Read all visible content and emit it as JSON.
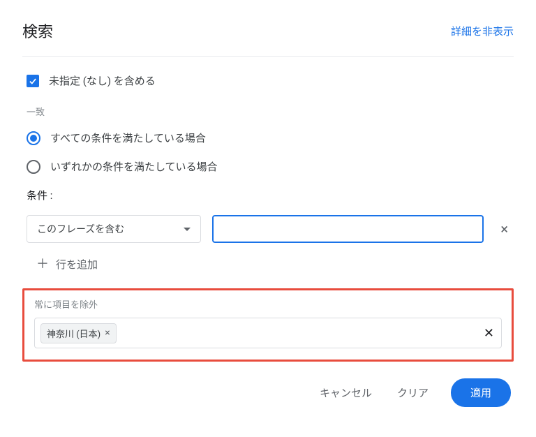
{
  "header": {
    "title": "検索",
    "hide_details": "詳細を非表示"
  },
  "include_unspecified": {
    "label": "未指定 (なし) を含める",
    "checked": true
  },
  "match": {
    "section_label": "一致",
    "options": [
      {
        "label": "すべての条件を満たしている場合",
        "selected": true
      },
      {
        "label": "いずれかの条件を満たしている場合",
        "selected": false
      }
    ]
  },
  "conditions": {
    "label": "条件 :",
    "rows": [
      {
        "dropdown": "このフレーズを含む",
        "value": ""
      }
    ],
    "add_row": "行を追加"
  },
  "exclude": {
    "label": "常に項目を除外",
    "chips": [
      {
        "text": "神奈川 (日本)"
      }
    ]
  },
  "footer": {
    "cancel": "キャンセル",
    "clear": "クリア",
    "apply": "適用"
  }
}
